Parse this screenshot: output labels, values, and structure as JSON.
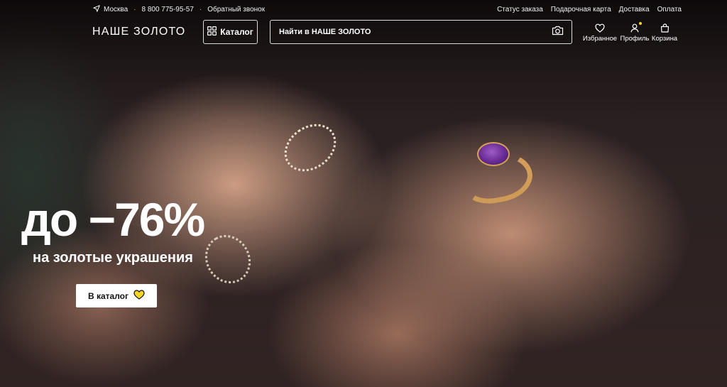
{
  "topbar": {
    "city": "Москва",
    "phone": "8 800 775-95-57",
    "callback": "Обратный звонок",
    "links": [
      "Статус заказа",
      "Подарочная карта",
      "Доставка",
      "Оплата"
    ]
  },
  "header": {
    "logo": "НАШЕ ЗОЛОТО",
    "catalog_label": "Каталог",
    "search_placeholder": "Найти в НАШЕ ЗОЛОТО",
    "nav": {
      "favorites": "Избранное",
      "profile": "Профиль",
      "cart": "Корзина"
    }
  },
  "hero": {
    "headline": "до −76%",
    "subline": "на золотые украшения",
    "cta_label": "В каталог"
  },
  "colors": {
    "accent_yellow": "#f5d627",
    "text": "#ffffff",
    "button_bg": "#ffffff"
  },
  "icons": [
    "location-arrow-icon",
    "grid-icon",
    "camera-icon",
    "heart-icon",
    "user-icon",
    "bag-icon",
    "yellow-heart-icon"
  ]
}
